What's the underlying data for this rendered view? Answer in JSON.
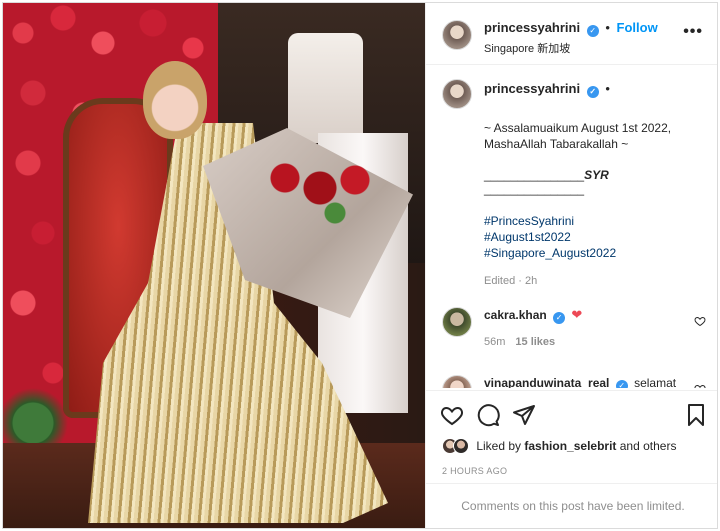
{
  "post": {
    "username": "princessyahrini",
    "verified_glyph": "✓",
    "dot": "•",
    "follow_label": "Follow",
    "location": "Singapore 新加坡",
    "more_label": "•••"
  },
  "caption": {
    "username": "princessyahrini",
    "text": "~ Assalamuaikum August 1st 2022,\nMashaAllah Tabarakallah ~",
    "separator_prefix": "_______________",
    "separator_signature": "SYR",
    "separator_line2": "_______________",
    "hashtags": [
      "#PrincesSyahrini",
      "#August1st2022",
      "#Singapore_August2022"
    ],
    "edited": "Edited · 2h"
  },
  "comments": [
    {
      "username": "cakra.khan",
      "verified": true,
      "text": "",
      "emoji": "❤",
      "age": "56m",
      "likes": "15 likes"
    },
    {
      "username": "vinapanduwinata_real",
      "verified": true,
      "text": "selamat",
      "emoji": "",
      "age": "",
      "likes": ""
    }
  ],
  "actions": {
    "icons": [
      "heart-icon",
      "comment-icon",
      "share-icon",
      "bookmark-icon"
    ]
  },
  "likes": {
    "prefix": "Liked by ",
    "user": "fashion_selebrit",
    "suffix": " and others"
  },
  "timestamp": "2 HOURS AGO",
  "comments_limited": "Comments on this post have been limited.",
  "colors": {
    "link_blue": "#0095f6",
    "hashtag": "#00376b",
    "verified": "#3897f0",
    "muted": "#8e8e8e",
    "border": "#efefef"
  }
}
